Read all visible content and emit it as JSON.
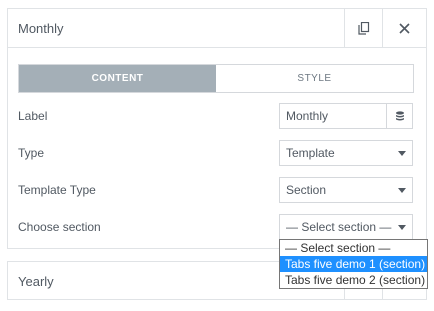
{
  "item1": {
    "title": "Monthly",
    "duplicate_icon": "duplicate-icon",
    "close_icon": "close-icon"
  },
  "tabs": [
    {
      "label": "CONTENT",
      "active": true
    },
    {
      "label": "STYLE",
      "active": false
    }
  ],
  "fields": {
    "label": {
      "label": "Label",
      "value": "Monthly",
      "dynamic_icon": "database-icon"
    },
    "type": {
      "label": "Type",
      "value": "Template"
    },
    "template_type": {
      "label": "Template Type",
      "value": "Section"
    },
    "choose_section": {
      "label": "Choose section",
      "value": "— Select section —"
    }
  },
  "dropdown": {
    "options": [
      {
        "label": "— Select section —",
        "selected": false
      },
      {
        "label": "Tabs five demo 1 (section)",
        "selected": true
      },
      {
        "label": "Tabs five demo 2 (section)",
        "selected": false
      }
    ]
  },
  "item2": {
    "title": "Yearly"
  },
  "colors": {
    "active_tab": "#a4afb7",
    "selected_option": "#1e90ff",
    "border": "#d5d8dc"
  }
}
